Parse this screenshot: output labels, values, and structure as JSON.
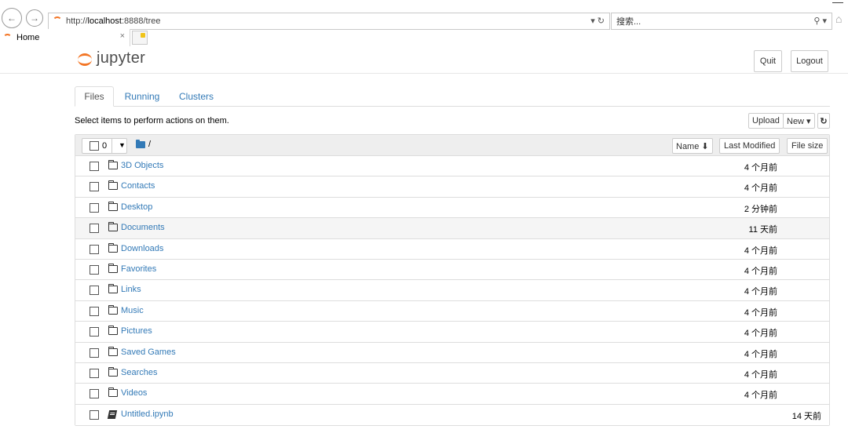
{
  "browser": {
    "url_prefix": "http://",
    "url_host": "localhost",
    "url_rest": ":8888/tree",
    "addr_controls": "▾ ↻",
    "search_placeholder": "搜索...",
    "search_controls": "⚲ ▾",
    "minimize_glyph": "—",
    "tab_title": "Home",
    "tab_close": "×"
  },
  "header": {
    "logo_text": "jupyter",
    "quit_label": "Quit",
    "logout_label": "Logout"
  },
  "tabs": [
    {
      "label": "Files",
      "active": true
    },
    {
      "label": "Running",
      "active": false
    },
    {
      "label": "Clusters",
      "active": false
    }
  ],
  "toolbar": {
    "hint": "Select items to perform actions on them.",
    "upload_label": "Upload",
    "new_label": "New ▾",
    "refresh_glyph": "↻"
  },
  "list_header": {
    "selected_count": "0",
    "caret": "▼",
    "path": "/",
    "sort_name_label": "Name ⬇",
    "sort_modified_label": "Last Modified",
    "sort_size_label": "File size"
  },
  "files": [
    {
      "name": "3D Objects",
      "type": "folder",
      "modified": "4 个月前"
    },
    {
      "name": "Contacts",
      "type": "folder",
      "modified": "4 个月前"
    },
    {
      "name": "Desktop",
      "type": "folder",
      "modified": "2 分钟前"
    },
    {
      "name": "Documents",
      "type": "folder",
      "modified": "11 天前"
    },
    {
      "name": "Downloads",
      "type": "folder",
      "modified": "4 个月前"
    },
    {
      "name": "Favorites",
      "type": "folder",
      "modified": "4 个月前"
    },
    {
      "name": "Links",
      "type": "folder",
      "modified": "4 个月前"
    },
    {
      "name": "Music",
      "type": "folder",
      "modified": "4 个月前"
    },
    {
      "name": "Pictures",
      "type": "folder",
      "modified": "4 个月前"
    },
    {
      "name": "Saved Games",
      "type": "folder",
      "modified": "4 个月前"
    },
    {
      "name": "Searches",
      "type": "folder",
      "modified": "4 个月前"
    },
    {
      "name": "Videos",
      "type": "folder",
      "modified": "4 个月前"
    },
    {
      "name": "Untitled.ipynb",
      "type": "notebook",
      "modified": "14 天前"
    }
  ],
  "colors": {
    "brand": "#f37626",
    "link": "#337ab7"
  }
}
